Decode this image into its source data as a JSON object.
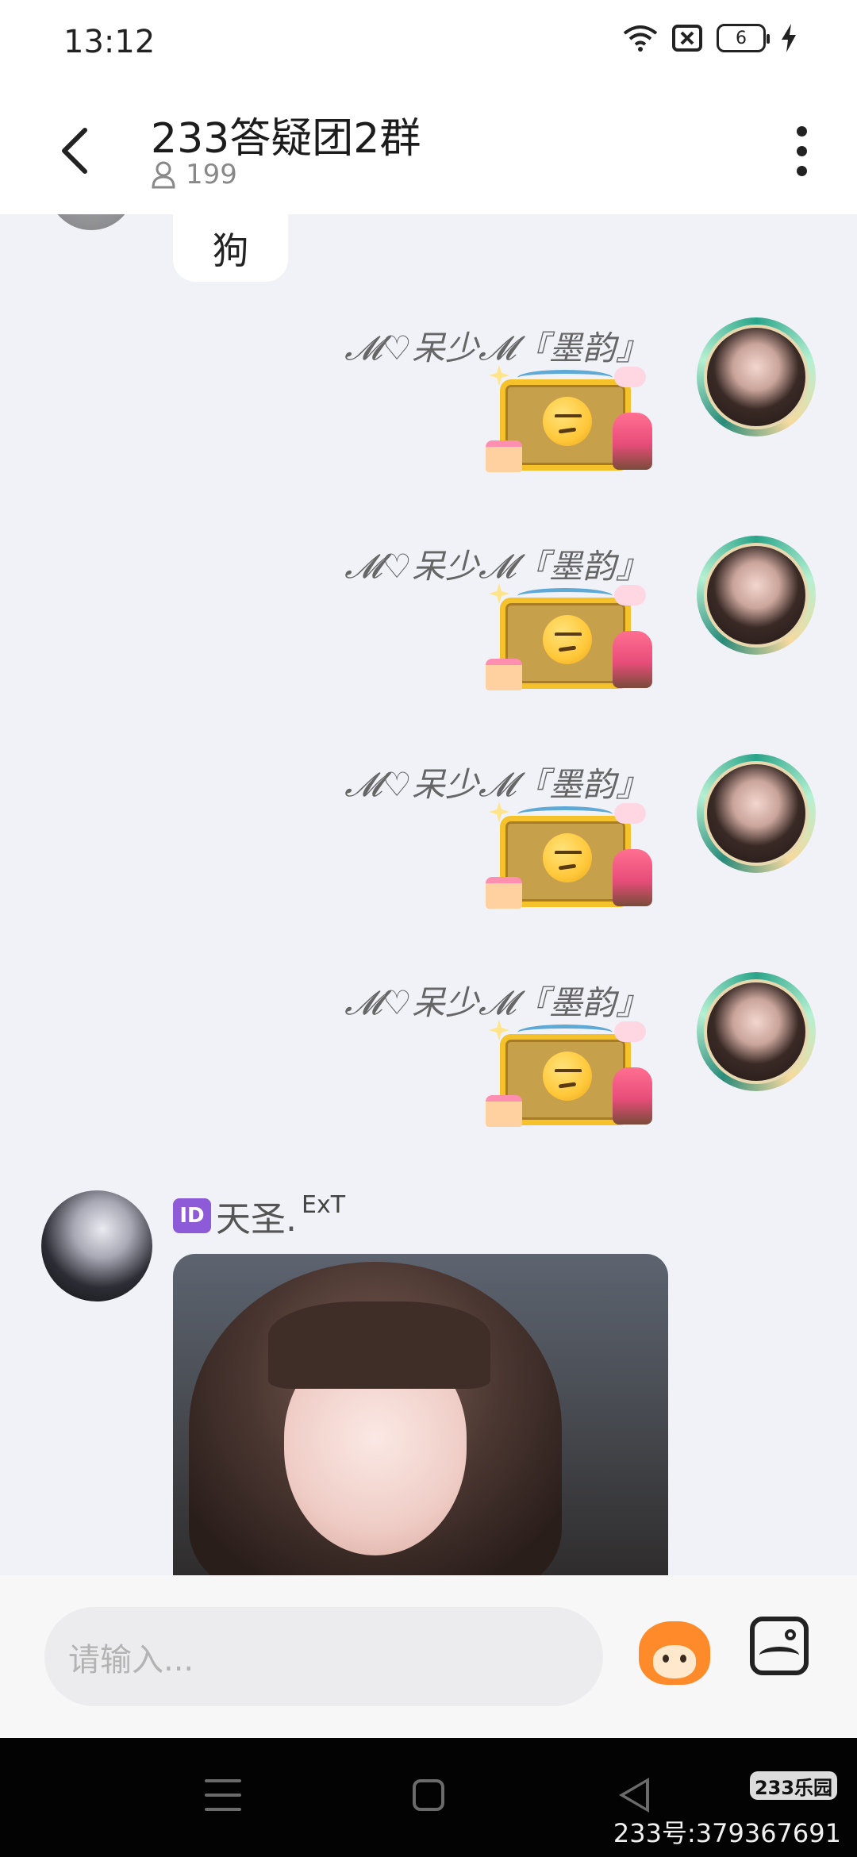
{
  "status_bar": {
    "time": "13:12",
    "battery_level": "6",
    "icons": [
      "wifi-icon",
      "sim-blocked-icon",
      "battery-icon",
      "charging-icon"
    ]
  },
  "header": {
    "title": "233答疑团2群",
    "member_count": "199",
    "icons": [
      "back-icon",
      "person-icon",
      "more-icon"
    ]
  },
  "chat": {
    "partial_message": "狗",
    "right_messages": [
      {
        "sender": "𝓜♡呆少𝓜『墨韵』",
        "content": "sticker-unamused"
      },
      {
        "sender": "𝓜♡呆少𝓜『墨韵』",
        "content": "sticker-unamused"
      },
      {
        "sender": "𝓜♡呆少𝓜『墨韵』",
        "content": "sticker-unamused"
      },
      {
        "sender": "𝓜♡呆少𝓜『墨韵』",
        "content": "sticker-unamused"
      }
    ],
    "left_message": {
      "badge": "ID",
      "sender": "天圣.",
      "tag": "ExT",
      "content": "photo"
    }
  },
  "input": {
    "placeholder": "请输入..."
  },
  "nav_bar": {
    "watermark_logo": "233乐园",
    "watermark_text": "233号:379367691"
  },
  "colors": {
    "chat_background": "#f1f2f8",
    "id_badge": "#8e5bd8",
    "sticker_frame": "#f5c22b"
  }
}
